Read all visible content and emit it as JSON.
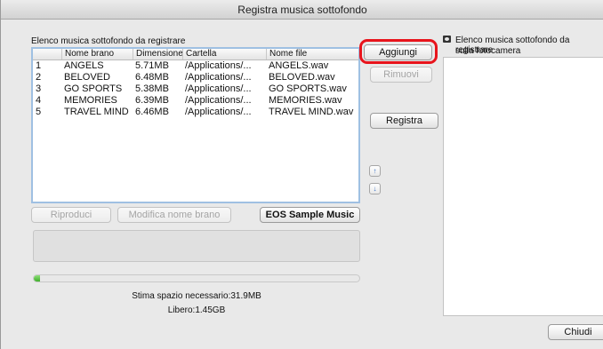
{
  "window": {
    "title": "Registra musica sottofondo"
  },
  "left": {
    "list_label": "Elenco musica sottofondo da registrare",
    "columns": [
      "Nome brano",
      "Dimensione",
      "Cartella",
      "Nome file"
    ],
    "rows": [
      {
        "n": "1",
        "name": "ANGELS",
        "size": "5.71MB",
        "folder": "/Applications/...",
        "file": "ANGELS.wav"
      },
      {
        "n": "2",
        "name": "BELOVED",
        "size": "6.48MB",
        "folder": "/Applications/...",
        "file": "BELOVED.wav"
      },
      {
        "n": "3",
        "name": "GO SPORTS",
        "size": "5.38MB",
        "folder": "/Applications/...",
        "file": "GO SPORTS.wav"
      },
      {
        "n": "4",
        "name": "MEMORIES",
        "size": "6.39MB",
        "folder": "/Applications/...",
        "file": "MEMORIES.wav"
      },
      {
        "n": "5",
        "name": "TRAVEL MIND",
        "size": "6.46MB",
        "folder": "/Applications/...",
        "file": "TRAVEL MIND.wav"
      }
    ],
    "play_button": "Riproduci",
    "rename_button": "Modifica nome brano",
    "sample_button": "EOS Sample Music",
    "progress_fraction": 0.02,
    "space_needed": "Stima spazio necessario:31.9MB",
    "free_space": "Libero:1.45GB"
  },
  "middle": {
    "add_button": "Aggiungi",
    "remove_button": "Rimuovi",
    "register_button": "Registra",
    "move_up_icon": "move-up-icon",
    "move_down_icon": "move-down-icon"
  },
  "right": {
    "camera_list_label_1": "Elenco musica sottofondo da registrare",
    "camera_list_label_2": "sulla fotocamera",
    "close_button": "Chiudi"
  },
  "colors": {
    "highlight": "#e8141c",
    "progress": "#3eae2a",
    "selection_border": "#9fc0e2"
  }
}
